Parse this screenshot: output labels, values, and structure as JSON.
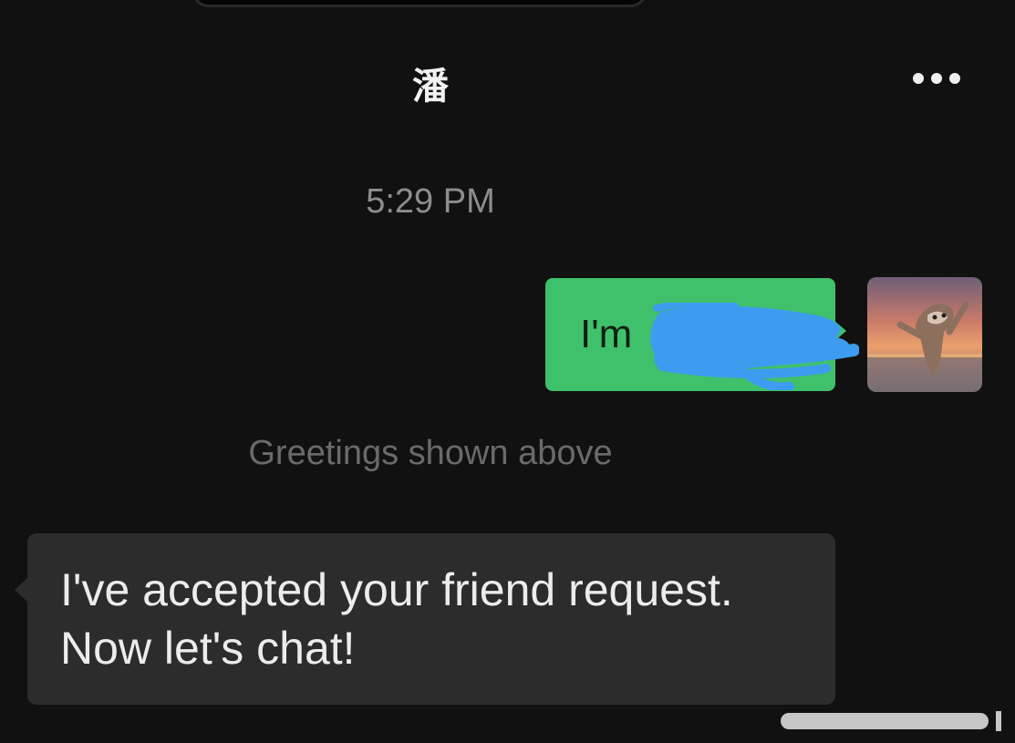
{
  "header": {
    "title": "潘",
    "more_icon": "more-dots-icon"
  },
  "chat": {
    "timestamp": "5:29 PM",
    "outgoing_message": {
      "text": "I'm",
      "bubble_color": "#3fc16b",
      "redaction_color": "#3d9cf0"
    },
    "system_note": "Greetings shown above",
    "incoming_message": {
      "lines": [
        "I've accepted your friend request.",
        "Now let's chat!"
      ],
      "bubble_color": "#2c2c2c"
    }
  },
  "colors": {
    "background": "#111111",
    "accent_green": "#3fc16b"
  }
}
